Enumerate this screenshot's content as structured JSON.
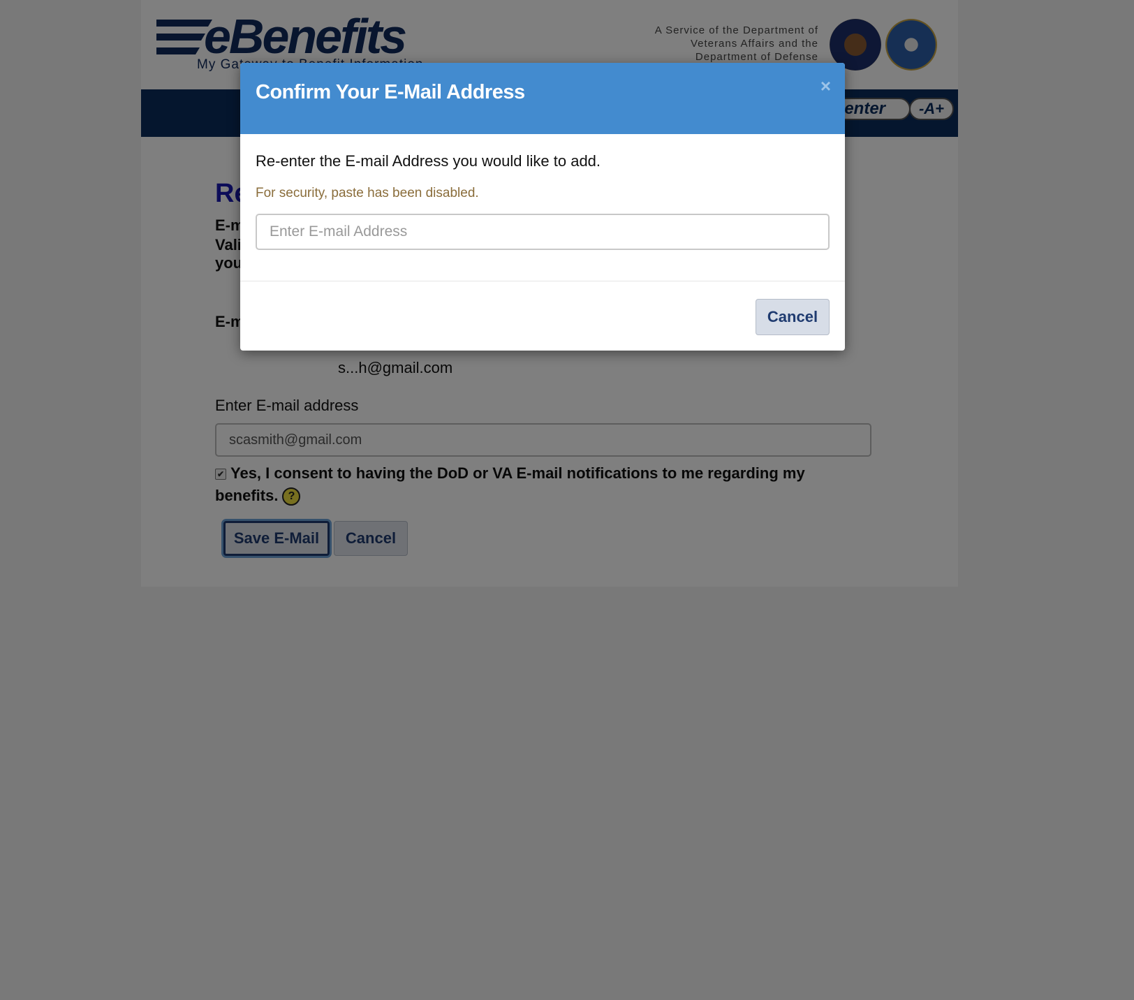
{
  "header": {
    "logo_text": "eBenefits",
    "logo_subtitle": "My Gateway to Benefit Information",
    "service_text": "A Service of the Department of Veterans Affairs and the Department of Defense"
  },
  "nav": {
    "center_label": "Center",
    "font_size_label": "-A+"
  },
  "background_page": {
    "title_fragment": "Re",
    "text_line_1": "E-m",
    "text_line_2": "Vali",
    "text_line_3": "you",
    "section_label": "E-m",
    "masked_email": "s...h@gmail.com",
    "email_label": "Enter E-mail address",
    "email_value": "scasmith@gmail.com",
    "consent_text": "Yes, I consent to having the DoD or VA E-mail notifications to me regarding my benefits.",
    "save_button": "Save E-Mail",
    "cancel_button": "Cancel"
  },
  "modal": {
    "title": "Confirm Your E-Mail Address",
    "close_symbol": "×",
    "instruction": "Re-enter the E-mail Address you would like to add.",
    "warning": "For security, paste has been disabled.",
    "input_placeholder": "Enter E-mail Address",
    "input_value": "",
    "cancel_button": "Cancel"
  },
  "icons": {
    "help": "?",
    "check": "✔"
  },
  "colors": {
    "modal_header": "#438bcf",
    "nav_bar": "#0b2c5c",
    "brand": "#102a5c",
    "warning": "#8a6d3b"
  }
}
